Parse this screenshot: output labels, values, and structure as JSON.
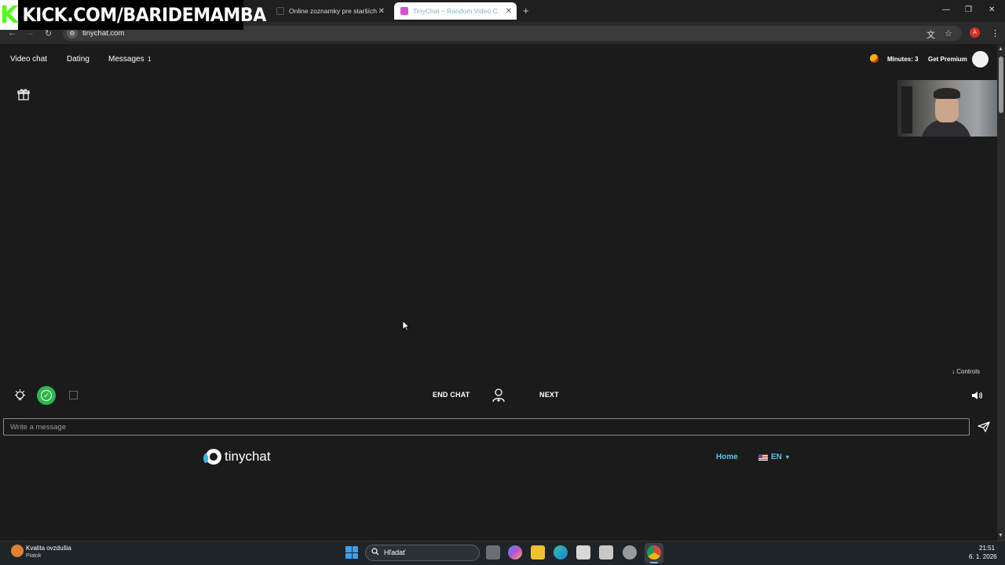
{
  "overlay": {
    "kick_logo": "K",
    "kick_text": "KICK.COM/BARIDEMAMBA"
  },
  "browser": {
    "tabs": [
      {
        "label": "Online zoznamky pre starších",
        "close": "✕"
      },
      {
        "label": "TinyChat – Random Video C",
        "close": "✕"
      }
    ],
    "new_tab": "+",
    "window_controls": {
      "minimize": "—",
      "maximize": "❐",
      "close": "✕"
    },
    "url": "tinychat.com",
    "profile_initial": "A"
  },
  "site": {
    "nav": {
      "video_chat": "Video chat",
      "dating": "Dating",
      "messages": "Messages",
      "messages_count": "1"
    },
    "minutes": "Minutes: 3",
    "premium": "Get Premium",
    "controls_link": "↓ Controls",
    "end_chat": "END CHAT",
    "next": "NEXT",
    "message_placeholder": "Write a message",
    "brand": "tinychat",
    "home": "Home",
    "language": "EN",
    "language_caret": "▾"
  },
  "taskbar": {
    "weather_title": "Kvalita ovzdušia",
    "weather_sub": "Piatok",
    "search_placeholder": "Hľadať",
    "time": "21:51",
    "date": "6. 1. 2026"
  },
  "colors": {
    "page_bg": "#1b1b1b",
    "accent_blue": "#57c7f0",
    "kick_green": "#53fc18",
    "check_green": "#2db84d"
  }
}
